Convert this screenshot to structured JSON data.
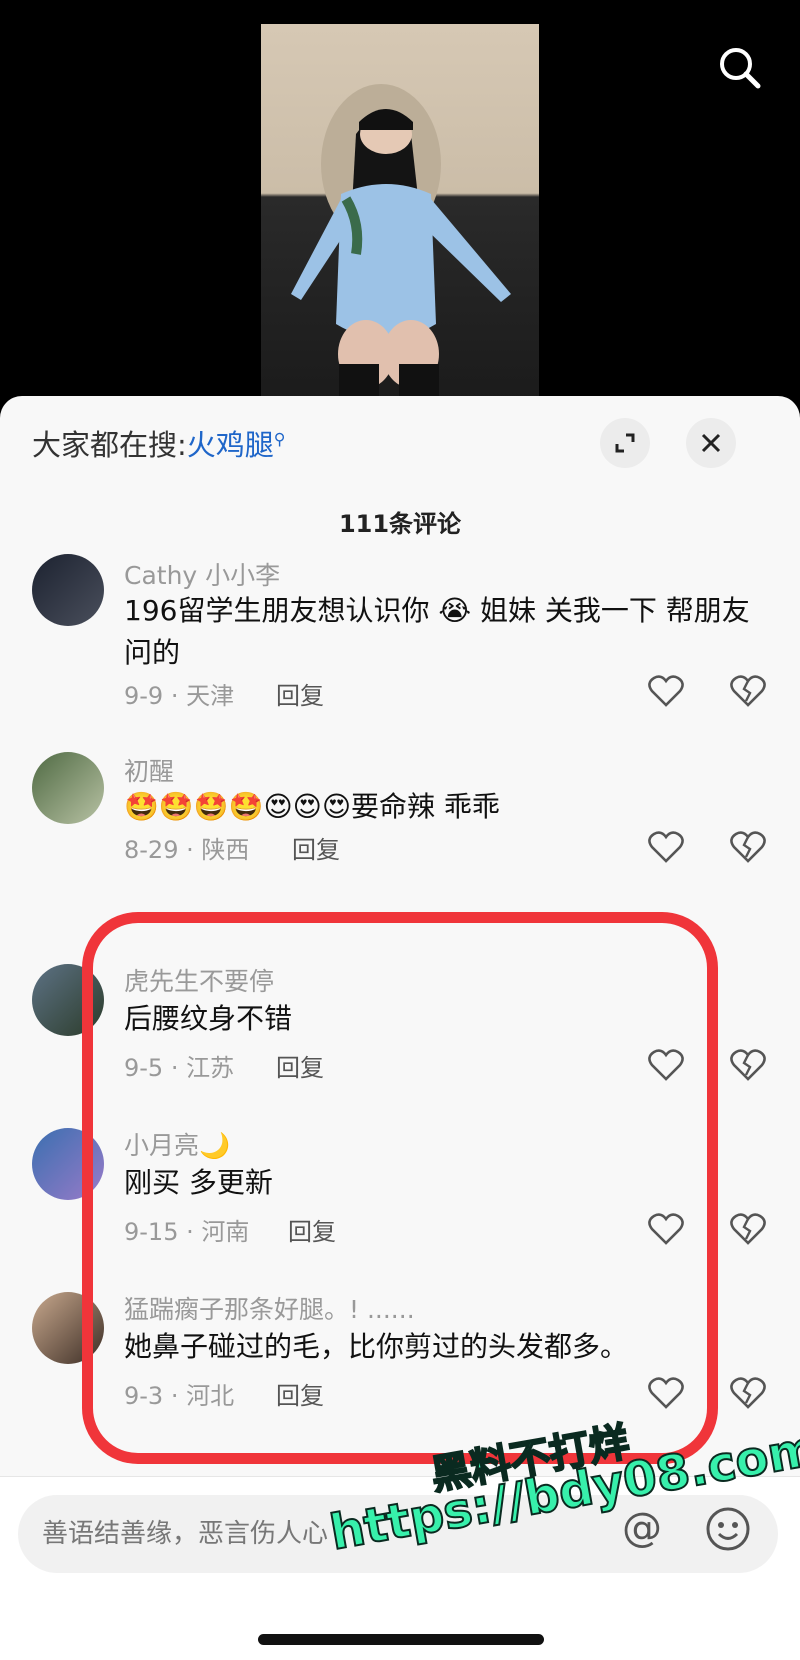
{
  "top_search": {
    "icon": "search-icon"
  },
  "sheet": {
    "everyone_label": "大家都在搜:",
    "everyone_keyword": "火鸡腿",
    "expand_icon": "expand-icon",
    "close_icon": "close-icon",
    "comment_count": "111条评论"
  },
  "comments": [
    {
      "user": "Cathy 小小李",
      "text": "196留学生朋友想认识你 😭 姐妹 关我一下 帮朋友问的",
      "date_loc": "9-9 · 天津",
      "reply": "回复"
    },
    {
      "user": "初醒",
      "text": "🤩🤩🤩🤩😍😍😍要命辣 乖乖",
      "date_loc": "8-29 · 陕西",
      "reply": "回复"
    },
    {
      "user": "虎先生不要停",
      "text": "后腰纹身不错",
      "date_loc": "9-5 · 江苏",
      "reply": "回复"
    },
    {
      "user": "小月亮🌙",
      "text": "刚买 多更新",
      "date_loc": "9-15 · 河南",
      "reply": "回复"
    },
    {
      "user": "猛踹瘸子那条好腿。! ......",
      "text": "她鼻子碰过的毛，比你剪过的头发都多。",
      "date_loc": "9-3 · 河北",
      "reply": "回复"
    }
  ],
  "input": {
    "placeholder": "善语结善缘，恶言伤人心",
    "at_symbol": "@"
  },
  "watermark": {
    "line1": "黑料不打烊",
    "line2": "https://bdy08.com"
  },
  "colors": {
    "highlight": "#f0353a",
    "keyword": "#1f66c9",
    "watermark": "#37f0ab"
  }
}
